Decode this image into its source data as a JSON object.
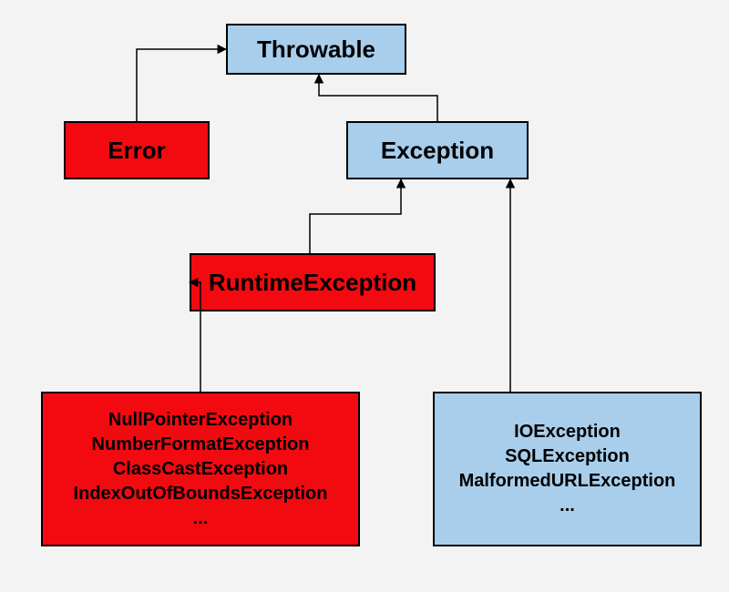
{
  "nodes": {
    "throwable": "Throwable",
    "error": "Error",
    "exception": "Exception",
    "runtime": "RuntimeException",
    "runtime_children": {
      "line1": "NullPointerException",
      "line2": "NumberFormatException",
      "line3": "ClassCastException",
      "line4": "IndexOutOfBoundsException",
      "line5": "..."
    },
    "exception_children": {
      "line1": "IOException",
      "line2": "SQLException",
      "line3": "MalformedURLException",
      "line4": "..."
    }
  },
  "edges": [
    {
      "from": "error",
      "to": "throwable"
    },
    {
      "from": "exception",
      "to": "throwable"
    },
    {
      "from": "runtime",
      "to": "exception"
    },
    {
      "from": "runtime-children",
      "to": "runtime"
    },
    {
      "from": "exception-children",
      "to": "exception"
    }
  ],
  "colors": {
    "blue_box": "#a8ceec",
    "red_box": "#f30a10",
    "background": "#f3f3f3",
    "border": "#000000"
  }
}
